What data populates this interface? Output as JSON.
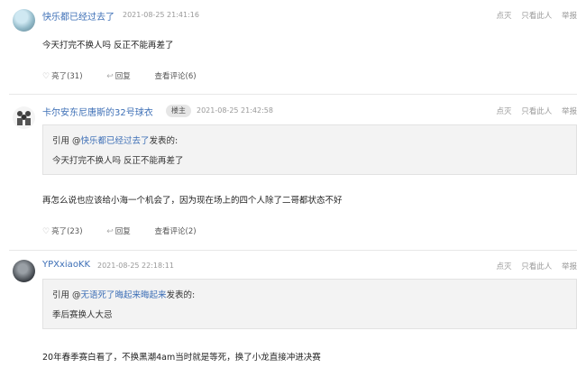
{
  "actions": {
    "like": "点灭",
    "report_user": "只看此人",
    "report": "举报"
  },
  "posts": [
    {
      "user": "快乐都已经过去了",
      "time": "2021-08-25 21:41:16",
      "content": "今天打完不换人吗 反正不能再差了",
      "likes_label": "亮了(31)",
      "reply_label": "回复",
      "view_label": "查看评论(6)"
    },
    {
      "user": "卡尔安东尼唐斯的32号球衣",
      "badge": "楼主",
      "time": "2021-08-25 21:42:58",
      "quote_prefix": "引用 @",
      "quote_user": "快乐都已经过去了",
      "quote_suffix": "发表的:",
      "quote_text": "今天打完不换人吗 反正不能再差了",
      "content": "再怎么说也应该给小海一个机会了，因为现在场上的四个人除了二哥都状态不好",
      "likes_label": "亮了(23)",
      "reply_label": "回复",
      "view_label": "查看评论(2)"
    },
    {
      "user": "YPXxiaoKK",
      "time": "2021-08-25 22:18:11",
      "quote_prefix": "引用 @",
      "quote_user": "无语死了晦起来晦起来",
      "quote_suffix": "发表的:",
      "quote_text": "季后赛换人大忌",
      "content": "20年春季赛白看了，不换黑潮4am当时就是等死，换了小龙直接冲进决赛"
    }
  ]
}
